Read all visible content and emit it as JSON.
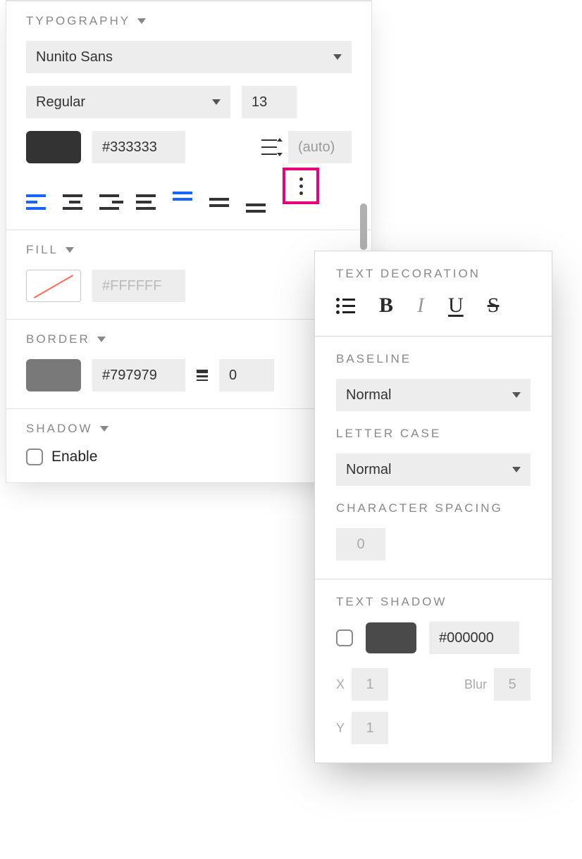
{
  "typography": {
    "title": "TYPOGRAPHY",
    "font_family": "Nunito Sans",
    "font_weight": "Regular",
    "font_size": "13",
    "color_swatch": "#333333",
    "color_hex": "#333333",
    "line_height": "(auto)"
  },
  "fill": {
    "title": "FILL",
    "color_hex": "#FFFFFF"
  },
  "border": {
    "title": "BORDER",
    "color_swatch": "#797979",
    "color_hex": "#797979",
    "width": "0"
  },
  "shadow": {
    "title": "SHADOW",
    "enable_label": "Enable"
  },
  "popover": {
    "text_decoration_title": "TEXT DECORATION",
    "baseline_title": "BASELINE",
    "baseline_value": "Normal",
    "letter_case_title": "LETTER CASE",
    "letter_case_value": "Normal",
    "char_spacing_title": "CHARACTER SPACING",
    "char_spacing_value": "0",
    "text_shadow_title": "TEXT SHADOW",
    "ts_color_swatch": "#4a4a4a",
    "ts_color_hex": "#000000",
    "ts_x_label": "X",
    "ts_x_value": "1",
    "ts_blur_label": "Blur",
    "ts_blur_value": "5",
    "ts_y_label": "Y",
    "ts_y_value": "1",
    "bold_glyph": "B",
    "italic_glyph": "I",
    "underline_glyph": "U",
    "strike_glyph": "S"
  }
}
